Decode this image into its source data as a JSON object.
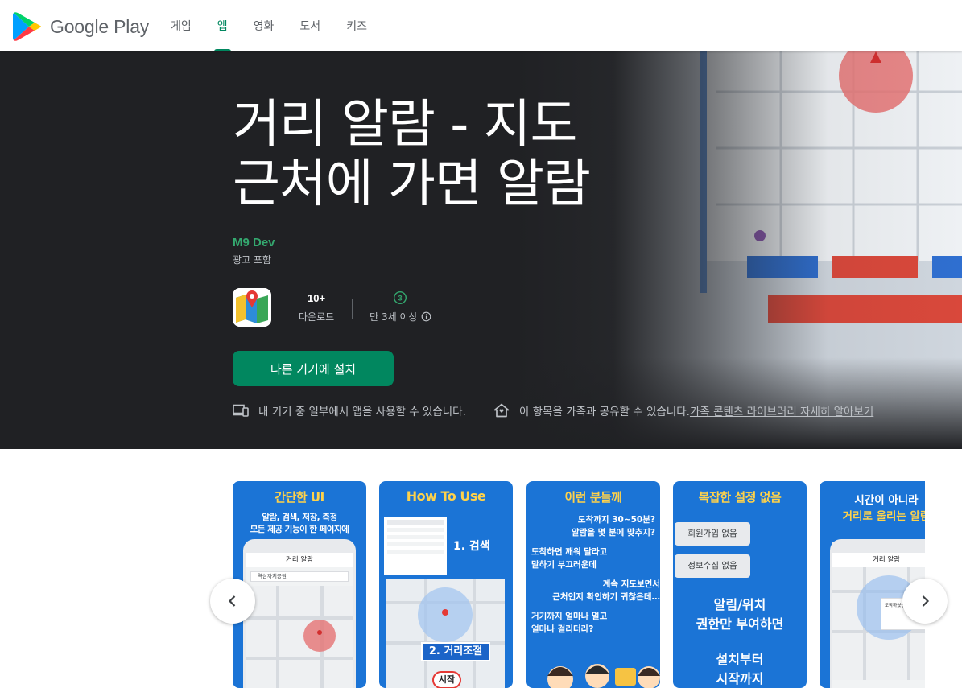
{
  "brand": {
    "name": "Google Play"
  },
  "nav": {
    "items": [
      {
        "label": "게임",
        "active": false
      },
      {
        "label": "앱",
        "active": true
      },
      {
        "label": "영화",
        "active": false
      },
      {
        "label": "도서",
        "active": false
      },
      {
        "label": "키즈",
        "active": false
      }
    ]
  },
  "app": {
    "title_line1": "거리 알람 - 지도",
    "title_line2": "근처에 가면 알람",
    "developer": "M9 Dev",
    "ads_note": "광고 포함",
    "downloads_value": "10+",
    "downloads_label": "다운로드",
    "rating_badge": "3",
    "rating_label": "만 3세 이상",
    "install_label": "다른 기기에 설치",
    "device_note": "내 기기 중 일부에서 앱을 사용할 수 있습니다.",
    "family_note": "이 항목을 가족과 공유할 수 있습니다.",
    "family_link": "가족 콘텐츠 라이브러리 자세히 알아보기"
  },
  "colors": {
    "accent": "#01875f",
    "hero_bg": "#202124",
    "developer": "#34a86f",
    "shot_bg": "#1b74d6",
    "shot_heading": "#ffd24a"
  },
  "screenshots": [
    {
      "heading": "간단한 UI",
      "sub1": "알람, 검색, 저장, 측정",
      "sub2": "모든 제공 기능이 한 페이지에",
      "app_bar": "거리 알람",
      "search": "역삼까치공원"
    },
    {
      "heading": "How To Use",
      "step1": "1. 검색",
      "step2": "2. 거리조절",
      "step3": "시작"
    },
    {
      "heading": "이런 분들께",
      "lines": [
        "도착까지 30~50분?",
        "알람을 몇 분에 맞추지?",
        "도착하면 깨워 달라고",
        "말하기 부끄러운데",
        "계속 지도보면서",
        "근처인지 확인하기 귀찮은데…",
        "거기까지 얼마나 멀고",
        "얼마나 걸리더라?"
      ]
    },
    {
      "heading": "복잡한 설정 없음",
      "chip1": "회원가입 없음",
      "chip2": "정보수집 없음",
      "text1": "알림/위치",
      "text2": "권한만 부여하면",
      "text3": "설치부터",
      "text4": "시작까지"
    },
    {
      "heading1": "시간이 아니라",
      "heading2": "거리로 울리는 알람",
      "app_bar": "거리 알람",
      "popup": "도착하였습니다."
    }
  ],
  "carousel": {
    "prev": "previous",
    "next": "next"
  }
}
